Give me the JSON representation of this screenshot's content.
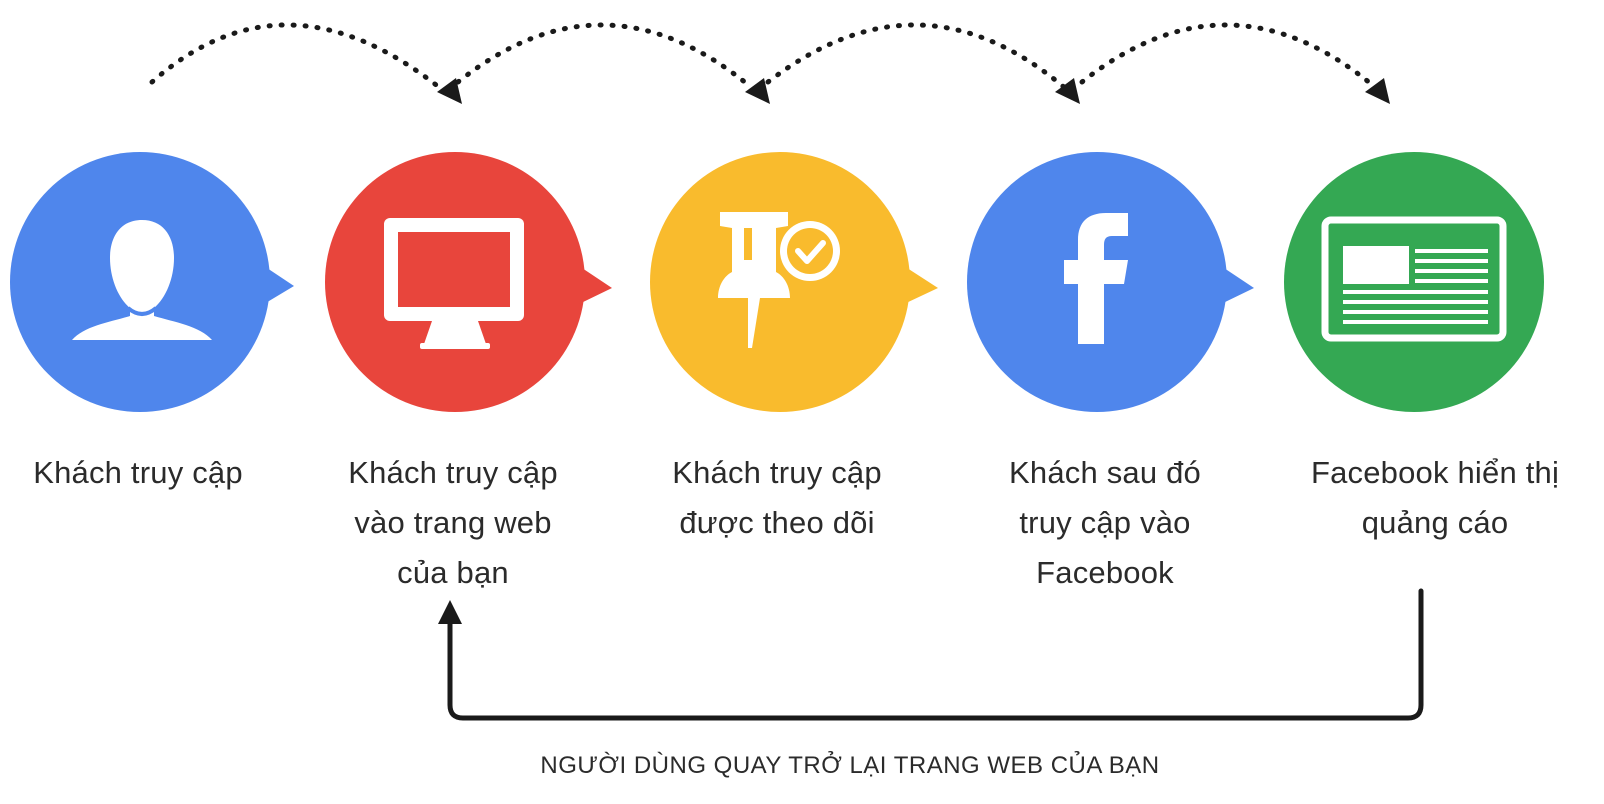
{
  "colors": {
    "blue": "#4f86ec",
    "red": "#e8453c",
    "yellow": "#f9bb2d",
    "green": "#34a853",
    "arrow": "#1a1a1a",
    "text": "#2b2b2b"
  },
  "steps": [
    {
      "label": "Khách truy cập",
      "icon": "user-icon",
      "color": "#4f86ec"
    },
    {
      "label": "Khách truy cập\nvào trang web\ncủa bạn",
      "icon": "monitor-icon",
      "color": "#e8453c"
    },
    {
      "label": "Khách truy cập\nđược theo dõi",
      "icon": "pin-check-icon",
      "color": "#f9bb2d"
    },
    {
      "label": "Khách sau đó\ntruy cập vào\nFacebook",
      "icon": "facebook-icon",
      "color": "#4f86ec"
    },
    {
      "label": "Facebook hiển thị\nquảng cáo",
      "icon": "ad-icon",
      "color": "#34a853"
    }
  ],
  "return_label": "NGƯỜI DÙNG QUAY TRỞ LẠI TRANG WEB CỦA BẠN"
}
